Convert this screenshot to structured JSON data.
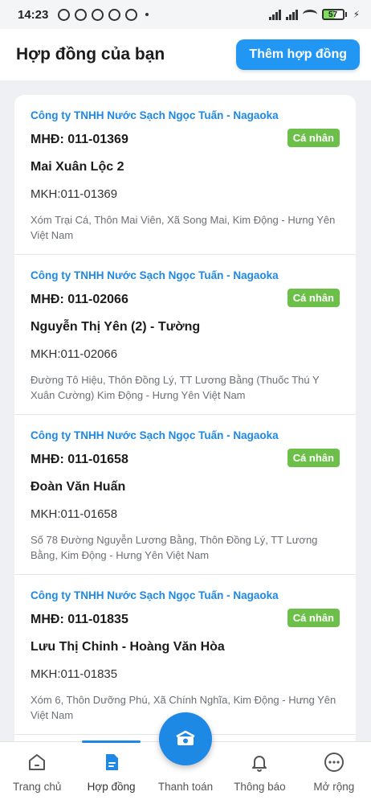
{
  "status_bar": {
    "time": "14:23",
    "battery": "57"
  },
  "header": {
    "title": "Hợp đồng của bạn",
    "add_button": "Thêm hợp đồng"
  },
  "contracts": [
    {
      "company": "Công ty TNHH Nước Sạch Ngọc Tuấn - Nagaoka",
      "contract_no": "MHĐ: 011-01369",
      "type": "Cá nhân",
      "customer": "Mai Xuân Lộc 2",
      "mkh": "MKH:011-01369",
      "address": "Xóm Trại Cá, Thôn Mai Viên, Xã Song Mai, Kim Động - Hưng Yên Việt Nam"
    },
    {
      "company": "Công ty TNHH Nước Sạch Ngọc Tuấn - Nagaoka",
      "contract_no": "MHĐ: 011-02066",
      "type": "Cá nhân",
      "customer": "Nguyễn Thị Yên (2) - Tường",
      "mkh": "MKH:011-02066",
      "address": "Đường Tô Hiệu, Thôn Đồng Lý, TT Lương Bằng (Thuốc Thú Y Xuân Cường) Kim Động - Hưng Yên Việt Nam"
    },
    {
      "company": "Công ty TNHH Nước Sạch Ngọc Tuấn - Nagaoka",
      "contract_no": "MHĐ: 011-01658",
      "type": "Cá nhân",
      "customer": "Đoàn Văn Huấn",
      "mkh": "MKH:011-01658",
      "address": "Số 78 Đường Nguyễn Lương Bằng, Thôn Đồng Lý, TT Lương Bằng, Kim Động - Hưng Yên Việt Nam"
    },
    {
      "company": "Công ty TNHH Nước Sạch Ngọc Tuấn - Nagaoka",
      "contract_no": "MHĐ: 011-01835",
      "type": "Cá nhân",
      "customer": "Lưu Thị Chinh - Hoàng Văn Hòa",
      "mkh": "MKH:011-01835",
      "address": "Xóm 6, Thôn Dưỡng Phú, Xã Chính Nghĩa, Kim Động - Hưng Yên Việt Nam"
    }
  ],
  "bottom_nav": [
    {
      "label": "Trang chủ",
      "icon": "home-icon"
    },
    {
      "label": "Hợp đồng",
      "icon": "document-icon"
    },
    {
      "label": "Thanh toán",
      "icon": "payment-icon"
    },
    {
      "label": "Thông báo",
      "icon": "bell-icon"
    },
    {
      "label": "Mở rộng",
      "icon": "more-icon"
    }
  ],
  "colors": {
    "primary": "#2196f3",
    "badge": "#6cc04a",
    "company_text": "#1e88e5"
  }
}
